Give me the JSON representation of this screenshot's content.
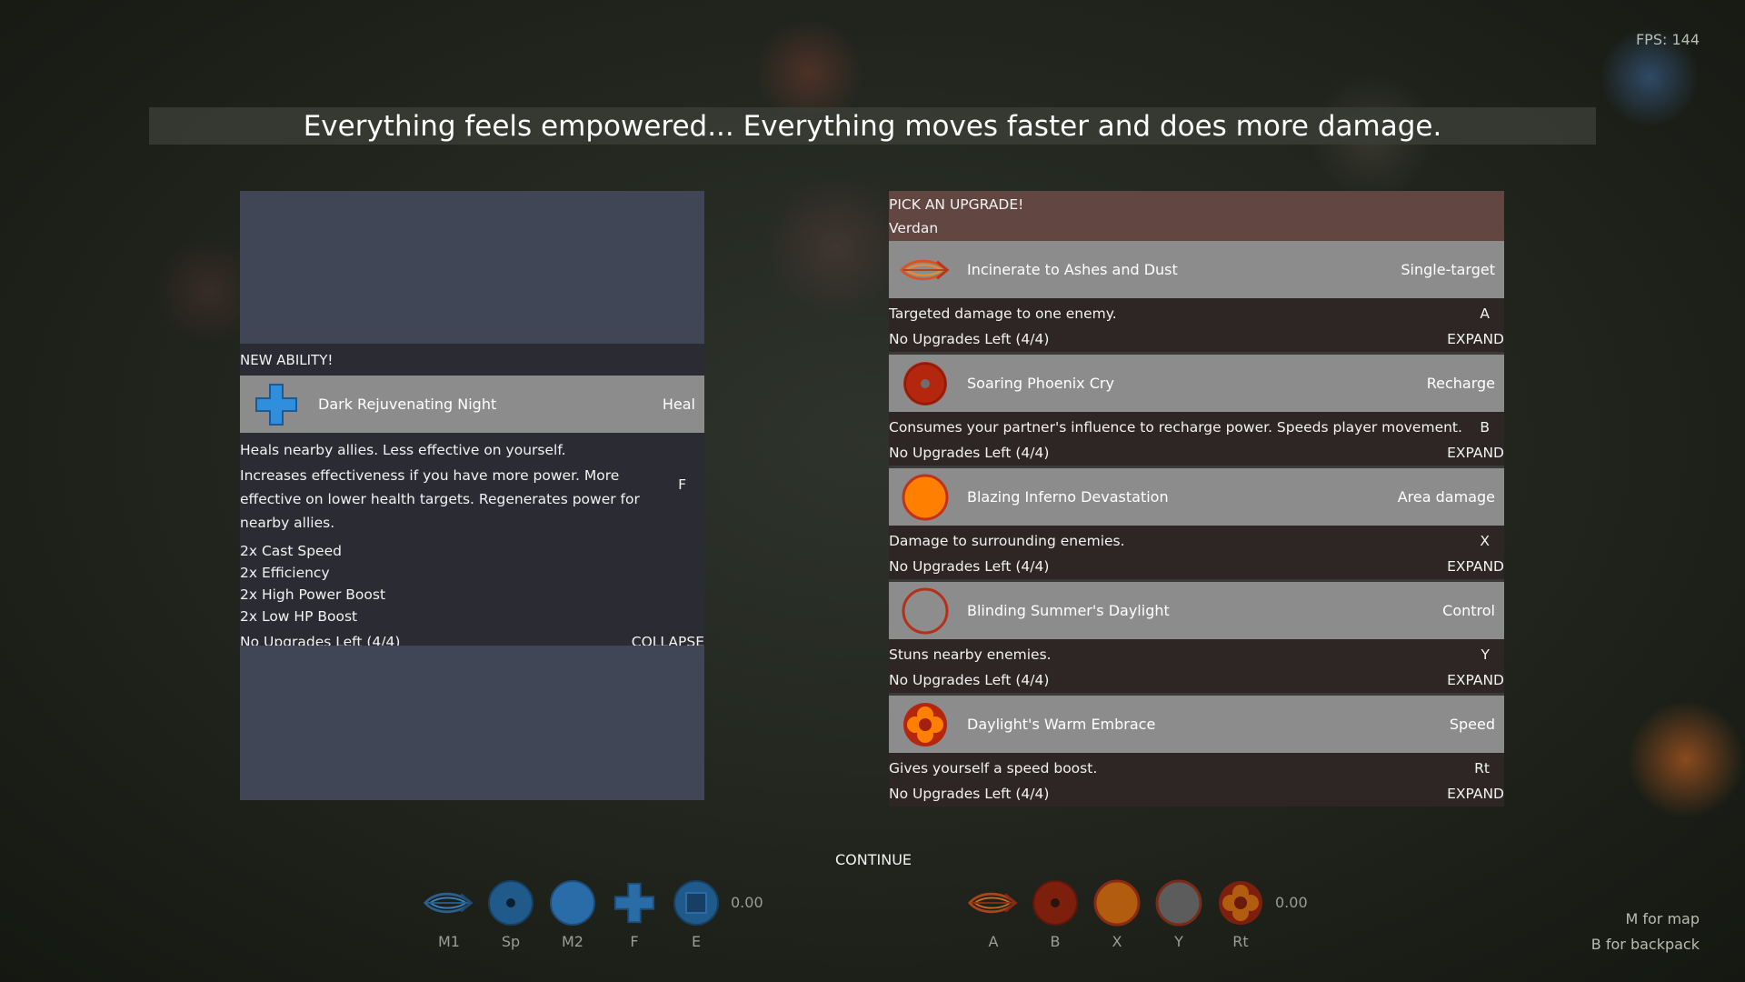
{
  "hud": {
    "fps": "FPS:  144"
  },
  "banner": {
    "text": "Everything feels empowered... Everything moves faster and does more damage."
  },
  "new_ability": {
    "section_label": "NEW ABILITY!",
    "name": "Dark Rejuvenating Night",
    "type": "Heal",
    "icon": "plus-icon",
    "key": "F",
    "description_lines": [
      "Heals nearby allies. Less effective on yourself.",
      "Increases effectiveness if you have more power. More",
      "effective on lower health targets. Regenerates power for",
      "nearby allies."
    ],
    "stats": [
      "2x Cast Speed",
      "2x Efficiency",
      "2x High Power Boost",
      "2x Low HP Boost"
    ],
    "upgrades_text": "No Upgrades Left (4/4)",
    "toggle_label": "COLLAPSE"
  },
  "upgrade_panel": {
    "title": "PICK AN UPGRADE!",
    "character": "Verdan",
    "abilities": [
      {
        "name": "Incinerate to Ashes and Dust",
        "type": "Single-target",
        "description": "Targeted damage to one enemy.",
        "key": "A",
        "upgrades_text": "No Upgrades Left (4/4)",
        "toggle_label": "EXPAND",
        "icon": "flame-bolt-icon"
      },
      {
        "name": "Soaring Phoenix Cry",
        "type": "Recharge",
        "description": "Consumes your partner's influence to recharge power. Speeds player movement.",
        "key": "B",
        "upgrades_text": "No Upgrades Left (4/4)",
        "toggle_label": "EXPAND",
        "icon": "dot-circle-icon"
      },
      {
        "name": "Blazing Inferno Devastation",
        "type": "Area damage",
        "description": "Damage to surrounding enemies.",
        "key": "X",
        "upgrades_text": "No Upgrades Left (4/4)",
        "toggle_label": "EXPAND",
        "icon": "orange-orb-icon"
      },
      {
        "name": "Blinding Summer's Daylight",
        "type": "Control",
        "description": "Stuns nearby enemies.",
        "key": "Y",
        "upgrades_text": "No Upgrades Left (4/4)",
        "toggle_label": "EXPAND",
        "icon": "grey-orb-icon"
      },
      {
        "name": "Daylight's Warm Embrace",
        "type": "Speed",
        "description": "Gives yourself a speed boost.",
        "key": "Rt",
        "upgrades_text": "No Upgrades Left (4/4)",
        "toggle_label": "EXPAND",
        "icon": "flower-icon"
      }
    ]
  },
  "continue_label": "CONTINUE",
  "hotbar_left": {
    "slots": [
      {
        "key": "M1",
        "icon": "blue-bolt-icon"
      },
      {
        "key": "Sp",
        "icon": "blue-dot-circle-icon"
      },
      {
        "key": "M2",
        "icon": "blue-orb-icon"
      },
      {
        "key": "F",
        "icon": "blue-plus-icon"
      },
      {
        "key": "E",
        "icon": "blue-square-icon"
      }
    ],
    "cooldown": "0.00"
  },
  "hotbar_right": {
    "slots": [
      {
        "key": "A",
        "icon": "flame-bolt-icon"
      },
      {
        "key": "B",
        "icon": "dot-circle-icon"
      },
      {
        "key": "X",
        "icon": "orange-orb-icon"
      },
      {
        "key": "Y",
        "icon": "grey-orb-icon"
      },
      {
        "key": "Rt",
        "icon": "flower-icon"
      }
    ],
    "cooldown": "0.00"
  },
  "hints": {
    "map": "M for map",
    "backpack": "B for backpack"
  },
  "colors": {
    "panel_slate": "#404656",
    "row_grey": "#8c8c8c",
    "header_brown": "#624641",
    "card_bg": "#2e2624",
    "accent_orange": "#ff7f00",
    "accent_red": "#c0321a",
    "accent_blue": "#2f8fdc"
  }
}
